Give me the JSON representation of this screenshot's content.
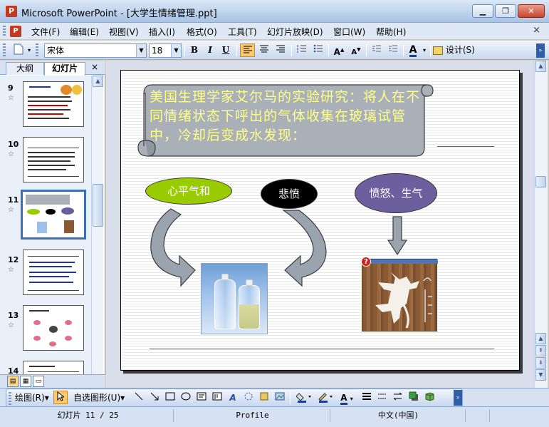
{
  "window": {
    "title": "Microsoft PowerPoint - [大学生情绪管理.ppt]",
    "app_icon": "P"
  },
  "menu": {
    "items": [
      "文件(F)",
      "编辑(E)",
      "视图(V)",
      "插入(I)",
      "格式(O)",
      "工具(T)",
      "幻灯片放映(D)",
      "窗口(W)",
      "帮助(H)"
    ],
    "close_glyph": "×"
  },
  "toolbar": {
    "font_name": "宋体",
    "font_size": "18",
    "bold": "B",
    "italic": "I",
    "underline": "U",
    "design_label": "设计(S)",
    "font_color_glyph": "A"
  },
  "left_pane": {
    "tabs": [
      "大纲",
      "幻灯片"
    ],
    "active_tab": "幻灯片",
    "thumbnails": [
      {
        "number": "9",
        "selected": false
      },
      {
        "number": "10",
        "selected": false
      },
      {
        "number": "11",
        "selected": true
      },
      {
        "number": "12",
        "selected": false
      },
      {
        "number": "13",
        "selected": false
      },
      {
        "number": "14",
        "selected": false
      }
    ]
  },
  "slide": {
    "banner_text": "美国生理学家艾尔马的实验研究：将人在不同情绪状态下呼出的气体收集在玻璃试管中，冷却后变成水发现：",
    "ovals": [
      {
        "label": "心平气和",
        "fill": "#99cc00",
        "text_color": "#ffffff"
      },
      {
        "label": "悲愤",
        "fill": "#000000",
        "text_color": "#ffffff"
      },
      {
        "label": "愤怒、生气",
        "fill": "#6b5f9e",
        "text_color": "#ffffff"
      }
    ],
    "help_badge": "?"
  },
  "drawing_toolbar": {
    "draw_label": "绘图(R)",
    "autoshapes_label": "自选图形(U)"
  },
  "status": {
    "slide_counter": "幻灯片 11 / 25",
    "design_template": "Profile",
    "language": "中文(中国)"
  },
  "colors": {
    "accent_blue": "#3c6fb4",
    "banner_fill": "#a9b0b8",
    "banner_text": "#ffff88",
    "arrow_fill": "#9aa4ae"
  }
}
